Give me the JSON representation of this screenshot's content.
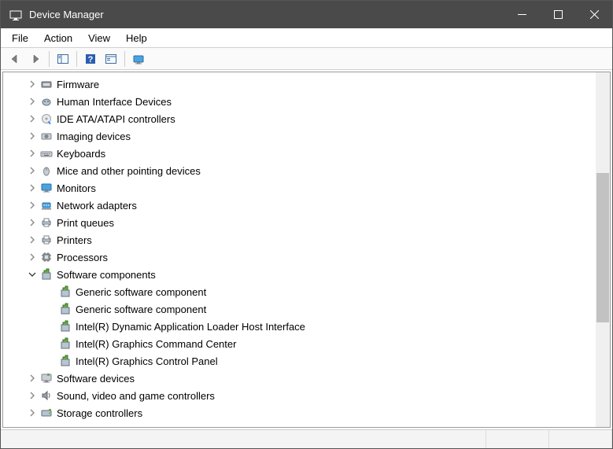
{
  "window": {
    "title": "Device Manager"
  },
  "menus": {
    "file": "File",
    "action": "Action",
    "view": "View",
    "help": "Help"
  },
  "tree": [
    {
      "type": "cat",
      "expanded": false,
      "icon": "firmware",
      "label": "Firmware"
    },
    {
      "type": "cat",
      "expanded": false,
      "icon": "hid",
      "label": "Human Interface Devices"
    },
    {
      "type": "cat",
      "expanded": false,
      "icon": "ide",
      "label": "IDE ATA/ATAPI controllers"
    },
    {
      "type": "cat",
      "expanded": false,
      "icon": "imaging",
      "label": "Imaging devices"
    },
    {
      "type": "cat",
      "expanded": false,
      "icon": "keyboard",
      "label": "Keyboards"
    },
    {
      "type": "cat",
      "expanded": false,
      "icon": "mouse",
      "label": "Mice and other pointing devices"
    },
    {
      "type": "cat",
      "expanded": false,
      "icon": "monitor",
      "label": "Monitors"
    },
    {
      "type": "cat",
      "expanded": false,
      "icon": "network",
      "label": "Network adapters"
    },
    {
      "type": "cat",
      "expanded": false,
      "icon": "printqueue",
      "label": "Print queues"
    },
    {
      "type": "cat",
      "expanded": false,
      "icon": "printer",
      "label": "Printers"
    },
    {
      "type": "cat",
      "expanded": false,
      "icon": "cpu",
      "label": "Processors"
    },
    {
      "type": "cat",
      "expanded": true,
      "icon": "software",
      "label": "Software components"
    },
    {
      "type": "dev",
      "icon": "software",
      "label": "Generic software component"
    },
    {
      "type": "dev",
      "icon": "software",
      "label": "Generic software component"
    },
    {
      "type": "dev",
      "icon": "software",
      "label": "Intel(R) Dynamic Application Loader Host Interface"
    },
    {
      "type": "dev",
      "icon": "software",
      "label": "Intel(R) Graphics Command Center"
    },
    {
      "type": "dev",
      "icon": "software",
      "label": "Intel(R) Graphics Control Panel"
    },
    {
      "type": "cat",
      "expanded": false,
      "icon": "softwaredev",
      "label": "Software devices"
    },
    {
      "type": "cat",
      "expanded": false,
      "icon": "sound",
      "label": "Sound, video and game controllers"
    },
    {
      "type": "cat",
      "expanded": false,
      "icon": "storage",
      "label": "Storage controllers"
    }
  ]
}
